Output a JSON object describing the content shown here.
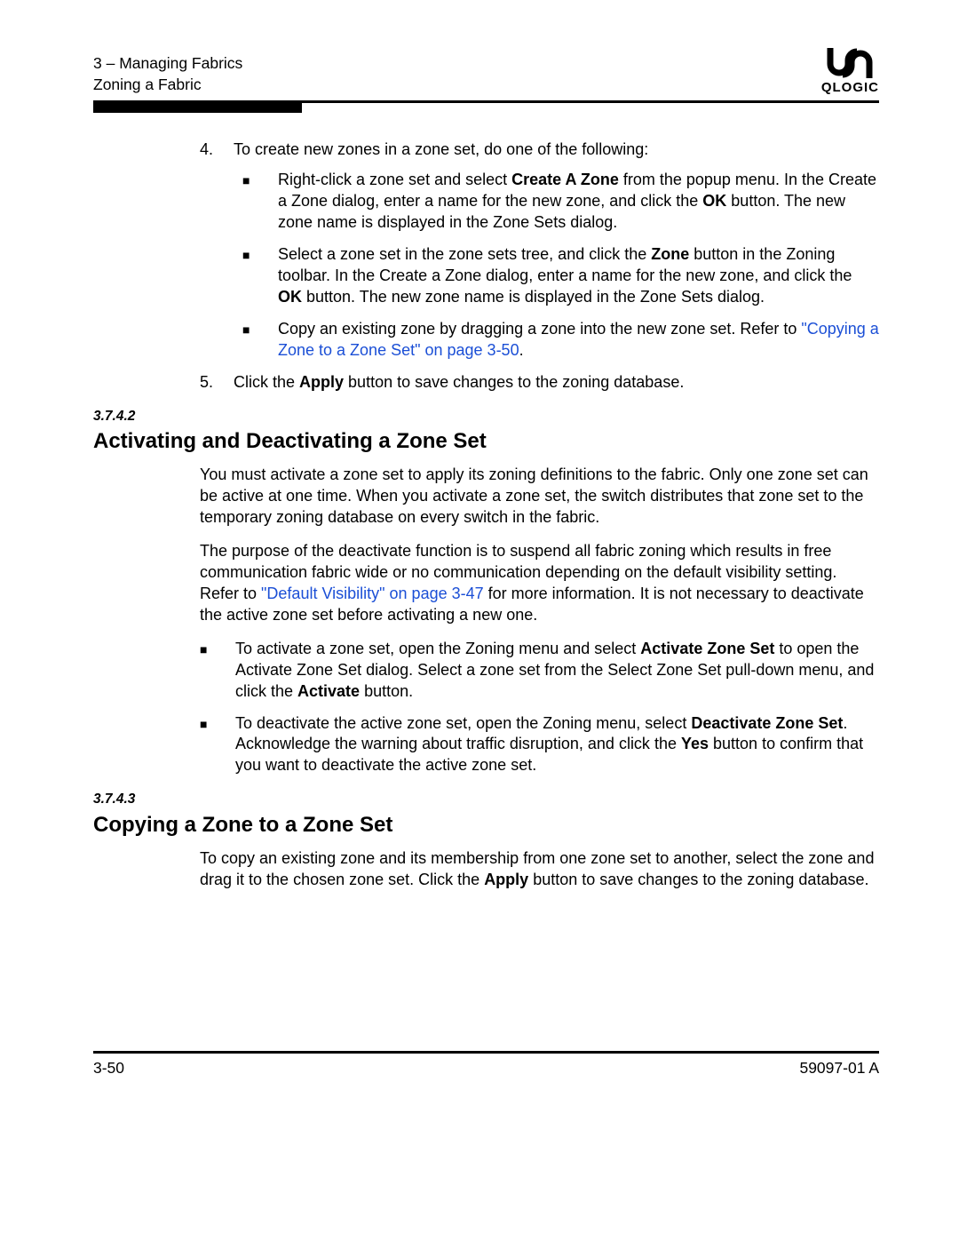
{
  "header": {
    "line1": "3 – Managing Fabrics",
    "line2": "Zoning a Fabric",
    "logo_text": "QLOGIC"
  },
  "list1": {
    "item4": {
      "num": "4.",
      "text": "To create new zones in a zone set, do one of the following:",
      "bullets": [
        {
          "pre": "Right-click a zone set and select ",
          "b1": "Create A Zone",
          "mid1": " from the popup menu. In the Create a Zone dialog, enter a name for the new zone, and click the ",
          "b2": "OK",
          "post": " button. The new zone name is displayed in the Zone Sets dialog."
        },
        {
          "pre": "Select a zone set in the zone sets tree, and click the ",
          "b1": "Zone",
          "mid1": " button in the Zoning toolbar. In the Create a Zone dialog, enter a name for the new zone, and click the ",
          "b2": "OK",
          "post": " button. The new zone name is displayed in the Zone Sets dialog."
        },
        {
          "pre": "Copy an existing zone by dragging a zone into the new zone set. Refer to ",
          "link": "\"Copying a Zone to a Zone Set\" on page 3-50",
          "post": "."
        }
      ]
    },
    "item5": {
      "num": "5.",
      "pre": "Click the ",
      "b": "Apply",
      "post": " button to save changes to the zoning database."
    }
  },
  "sec2": {
    "num": "3.7.4.2",
    "title": "Activating and Deactivating a Zone Set",
    "p1": "You must activate a zone set to apply its zoning definitions to the fabric. Only one zone set can be active at one time. When you activate a zone set, the switch distributes that zone set to the temporary zoning database on every switch in the fabric.",
    "p2_pre": "The purpose of the deactivate function is to suspend all fabric zoning which results in free communication fabric wide or no communication depending on the default visibility setting. Refer to ",
    "p2_link": "\"Default Visibility\" on page 3-47",
    "p2_post": " for more information. It is not necessary to deactivate the active zone set before activating a new one.",
    "b1_pre": "To activate a zone set, open the Zoning menu and select ",
    "b1_bold1": "Activate Zone Set",
    "b1_mid": " to open the Activate Zone Set dialog. Select a zone set from the Select Zone Set pull-down menu, and click the ",
    "b1_bold2": "Activate",
    "b1_post": " button.",
    "b2_pre": "To deactivate the active zone set, open the Zoning menu, select ",
    "b2_bold1": "Deactivate Zone Set",
    "b2_mid": ". Acknowledge the warning about traffic disruption, and click the ",
    "b2_bold2": "Yes",
    "b2_post": " button to confirm that you want to deactivate the active zone set."
  },
  "sec3": {
    "num": "3.7.4.3",
    "title": "Copying a Zone to a Zone Set",
    "p_pre": "To copy an existing zone and its membership from one zone set to another, select the zone and drag it to the chosen zone set. Click the ",
    "p_bold": "Apply",
    "p_post": " button to save changes to the zoning database."
  },
  "footer": {
    "left": "3-50",
    "right": "59097-01 A"
  }
}
